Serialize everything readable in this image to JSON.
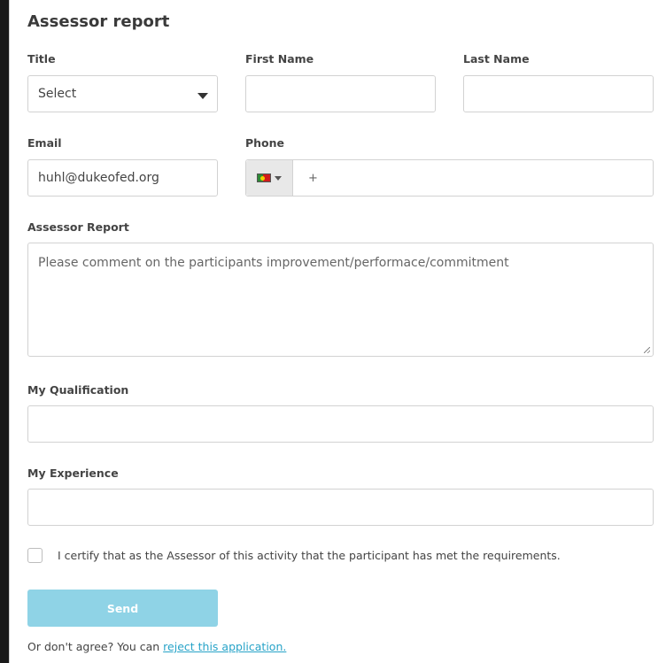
{
  "title": "Assessor report",
  "fields": {
    "title_label": "Title",
    "title_value": "Select",
    "first_name_label": "First Name",
    "first_name_value": "",
    "last_name_label": "Last Name",
    "last_name_value": "",
    "email_label": "Email",
    "email_value": "huhl@dukeofed.org",
    "phone_label": "Phone",
    "phone_value": "+",
    "phone_flag_icon": "portugal-flag-icon",
    "report_label": "Assessor Report",
    "report_placeholder": "Please comment on the participants improvement/performace/commitment",
    "qualification_label": "My Qualification",
    "qualification_value": "",
    "experience_label": "My Experience",
    "experience_value": ""
  },
  "certify": {
    "checked": false,
    "label": "I certify that as the Assessor of this activity that the participant has met the requirements."
  },
  "send_label": "Send",
  "footer": {
    "prefix": "Or don't agree? You can ",
    "link": "reject this application."
  },
  "colors": {
    "send_button": "#8fd3e6",
    "link": "#27a3c8"
  }
}
